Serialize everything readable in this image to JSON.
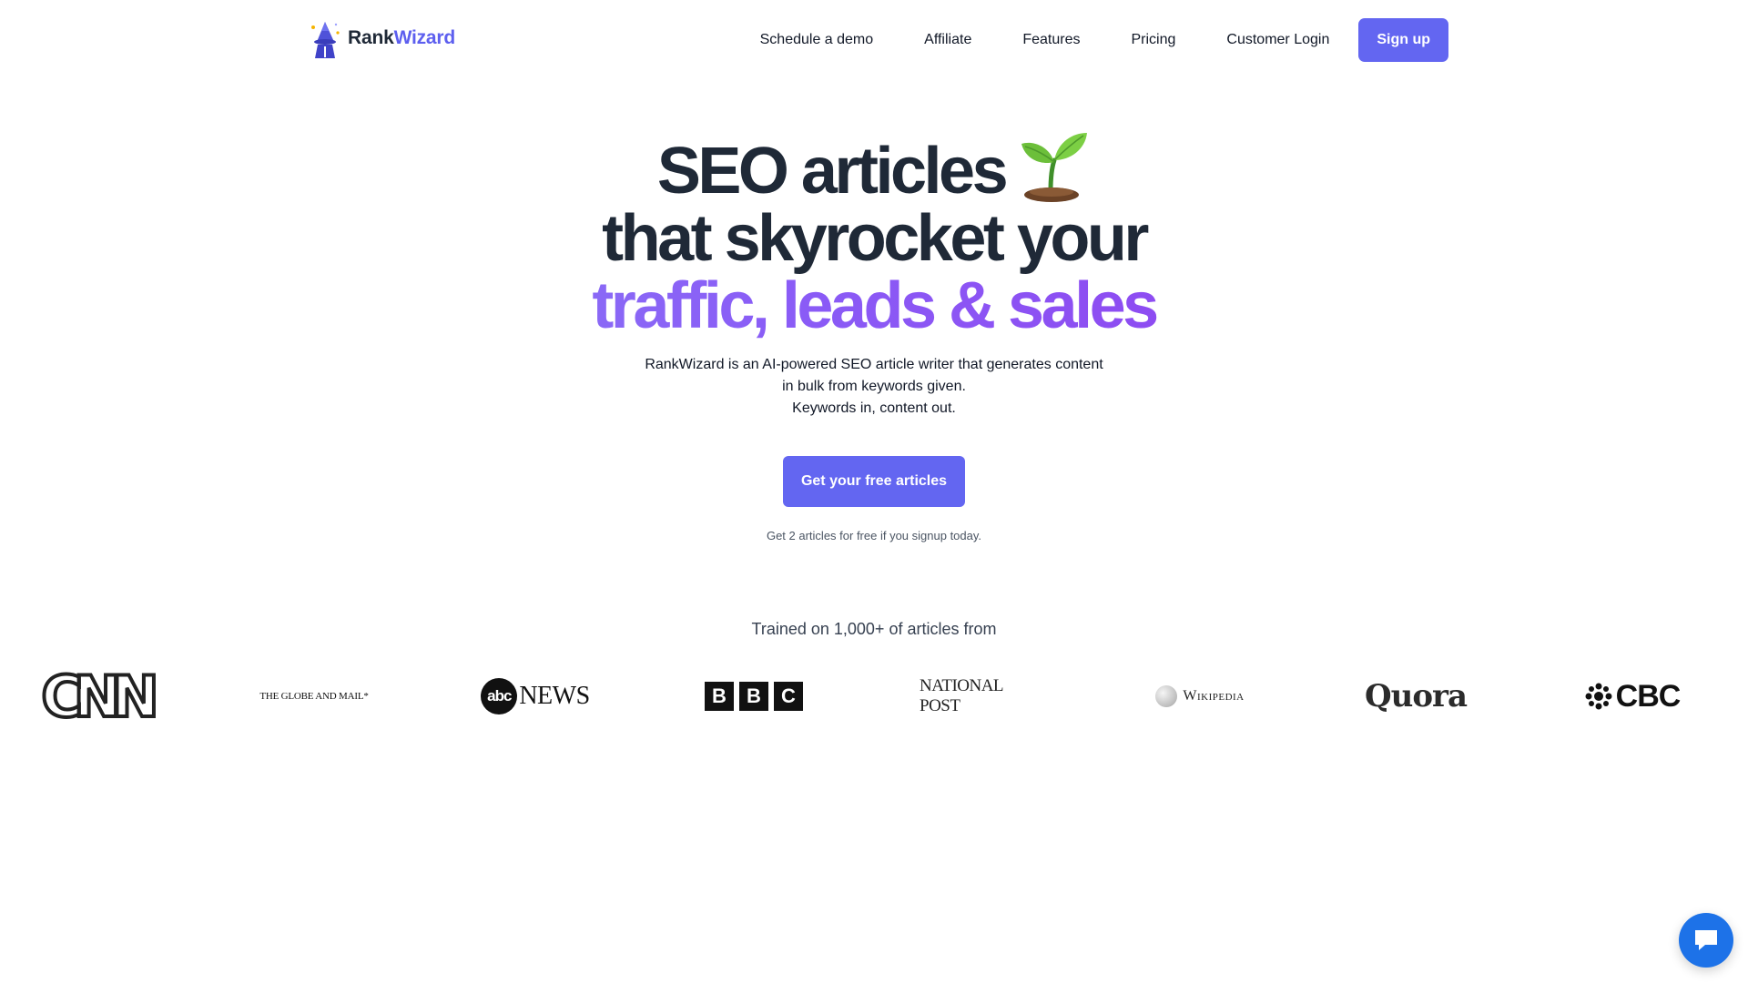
{
  "brand": {
    "name_part1": "Rank",
    "name_part2": "Wizard"
  },
  "nav": {
    "links": [
      "Schedule a demo",
      "Affiliate",
      "Features",
      "Pricing",
      "Customer Login"
    ],
    "signup_label": "Sign up"
  },
  "hero": {
    "line1": "SEO articles",
    "line1_emoji_icon": "seedling-icon",
    "line2": "that skyrocket your",
    "line3": "traffic, leads & sales",
    "description": [
      "RankWizard is an AI-powered SEO article writer that generates content",
      "in bulk from keywords given.",
      "Keywords in, content out."
    ],
    "cta_label": "Get your free articles",
    "cta_note": "Get 2 articles for free if you signup today."
  },
  "trained": {
    "heading": "Trained on 1,000+ of articles from",
    "logos": {
      "cnn": "CNN",
      "globe": "THE GLOBE AND MAIL*",
      "abc_disc": "abc",
      "abc_news": "NEWS",
      "bbc": [
        "B",
        "B",
        "C"
      ],
      "national_post": "NATIONAL POST",
      "wikipedia": "Wikipedia",
      "quora": "Quora",
      "cbc": "CBC"
    }
  },
  "colors": {
    "accent": "#6366f1",
    "headline": "#1f2937",
    "gradient_start": "#8b8ff5",
    "gradient_end": "#9333ea",
    "chat": "#1d72e8"
  },
  "icons": {
    "logo": "wizard-logo-icon",
    "chat": "chat-bubble-icon"
  }
}
